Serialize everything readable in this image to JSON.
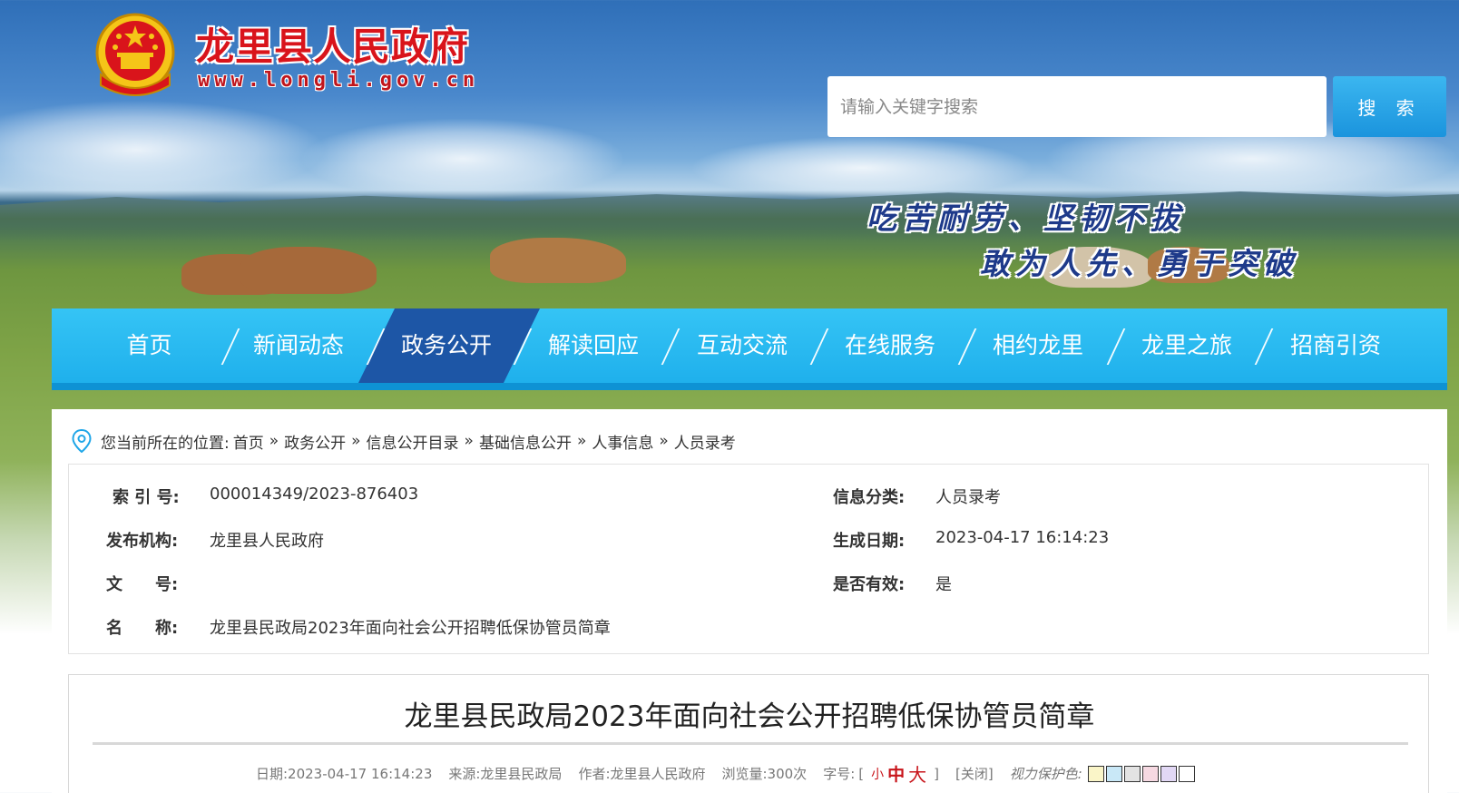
{
  "header": {
    "site_title": "龙里县人民政府",
    "site_url": "www.longli.gov.cn",
    "search": {
      "placeholder": "请输入关键字搜索",
      "button_label": "搜 索"
    },
    "slogans": [
      "吃苦耐劳、坚韧不拔",
      "敢为人先、勇于突破"
    ]
  },
  "nav": {
    "items": [
      {
        "label": "首页"
      },
      {
        "label": "新闻动态"
      },
      {
        "label": "政务公开",
        "active": true
      },
      {
        "label": "解读回应"
      },
      {
        "label": "互动交流"
      },
      {
        "label": "在线服务"
      },
      {
        "label": "相约龙里"
      },
      {
        "label": "龙里之旅"
      },
      {
        "label": "招商引资"
      }
    ]
  },
  "breadcrumb": {
    "prefix": "您当前所在的位置:",
    "items": [
      "首页",
      "政务公开",
      "信息公开目录",
      "基础信息公开",
      "人事信息",
      "人员录考"
    ],
    "separator": "»"
  },
  "meta": {
    "index_label": "索 引 号:",
    "index_value": "000014349/2023-876403",
    "category_label": "信息分类:",
    "category_value": "人员录考",
    "publisher_label": "发布机构:",
    "publisher_value": "龙里县人民政府",
    "date_label": "生成日期:",
    "date_value": "2023-04-17 16:14:23",
    "doc_no_label": "文　　号:",
    "doc_no_value": "",
    "valid_label": "是否有效:",
    "valid_value": "是",
    "name_label": "名　　称:",
    "name_value": "龙里县民政局2023年面向社会公开招聘低保协管员简章"
  },
  "article": {
    "title": "龙里县民政局2023年面向社会公开招聘低保协管员简章",
    "date": "日期:2023-04-17 16:14:23",
    "source": "来源:龙里县民政局",
    "author": "作者:龙里县人民政府",
    "views": "浏览量:300次",
    "font_size_label": "字号:",
    "bracket_open": "[",
    "font_small": "小",
    "font_mid": "中",
    "font_big": "大",
    "bracket_close": "]",
    "close_label": "[关闭]",
    "eye_care_label": "视力保护色:",
    "eye_care_colors": [
      "#faf5c8",
      "#c9e8f7",
      "#e3e3e3",
      "#f6d9e2",
      "#e2d8f5",
      "#ffffff"
    ]
  },
  "colors": {
    "nav_bg": "#22b5ee",
    "nav_active": "#1d56a6",
    "title_red": "#d9141b"
  }
}
